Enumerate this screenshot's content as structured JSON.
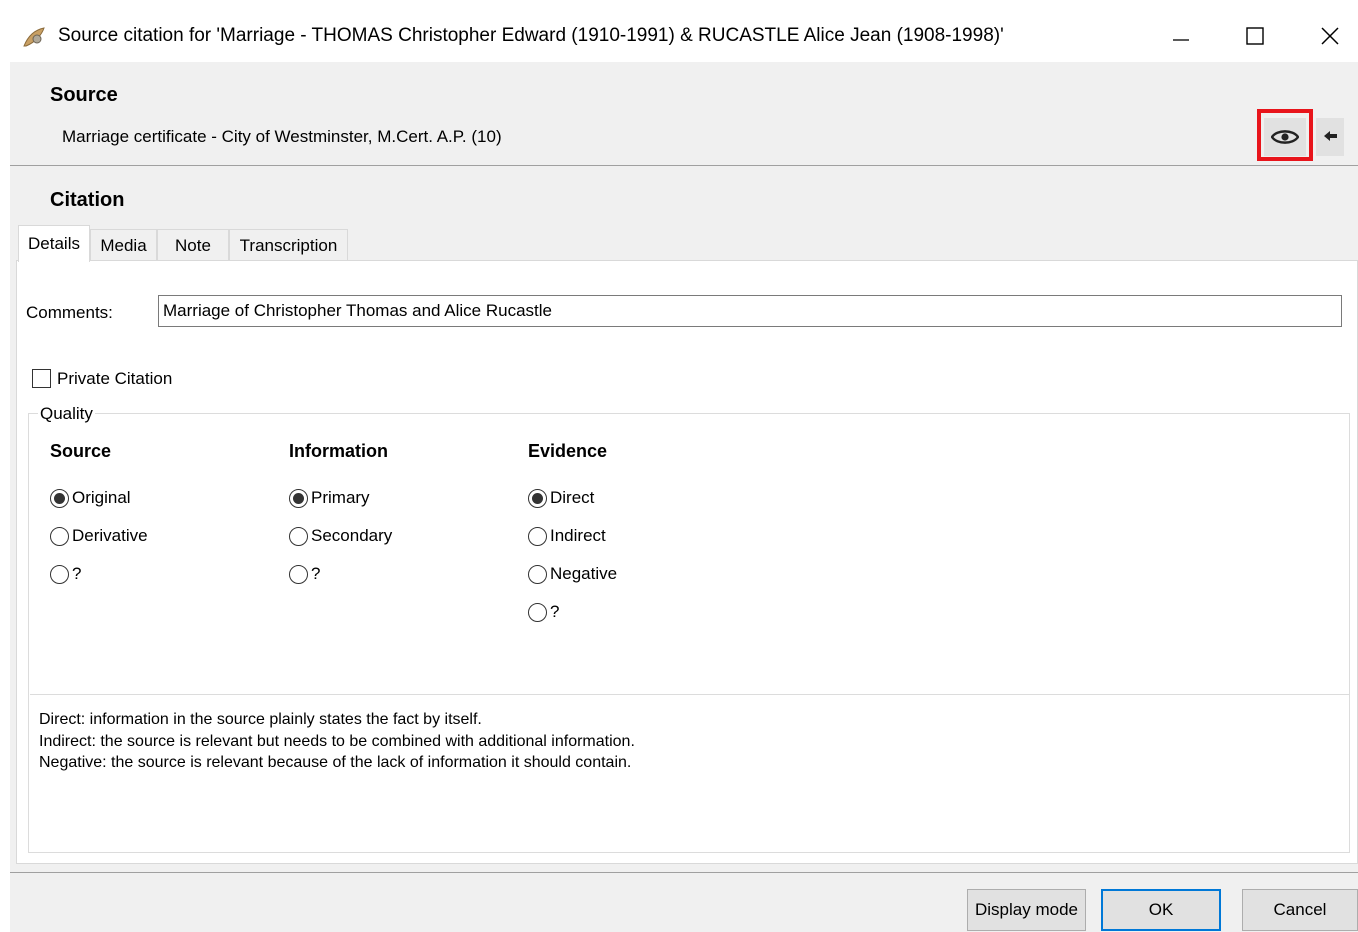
{
  "window": {
    "title": "Source citation for 'Marriage - THOMAS Christopher Edward (1910-1991) & RUCASTLE Alice Jean (1908-1998)'",
    "controls": [
      "minimize-icon",
      "maximize-icon",
      "close-icon"
    ]
  },
  "source": {
    "heading": "Source",
    "value": "Marriage certificate - City of Westminster, M.Cert. A.P. (10)",
    "view_icon": "eye-icon",
    "go_icon": "arrow-left-icon",
    "highlight_color": "#e8141b"
  },
  "citation": {
    "heading": "Citation",
    "tabs": [
      {
        "label": "Details",
        "active": true
      },
      {
        "label": "Media",
        "active": false
      },
      {
        "label": "Note",
        "active": false
      },
      {
        "label": "Transcription",
        "active": false
      }
    ],
    "comments_label": "Comments:",
    "comments_value": "Marriage of Christopher Thomas and Alice Rucastle",
    "private_label": "Private Citation",
    "private_checked": false,
    "quality": {
      "legend": "Quality",
      "source": {
        "heading": "Source",
        "options": [
          "Original",
          "Derivative",
          "?"
        ],
        "selected": "Original"
      },
      "information": {
        "heading": "Information",
        "options": [
          "Primary",
          "Secondary",
          "?"
        ],
        "selected": "Primary"
      },
      "evidence": {
        "heading": "Evidence",
        "options": [
          "Direct",
          "Indirect",
          "Negative",
          "?"
        ],
        "selected": "Direct"
      },
      "help_lines": [
        "Direct: information in the source plainly states the fact by itself.",
        "Indirect: the source is relevant but needs to be combined with additional information.",
        "Negative: the source is relevant because of the lack of information it should contain."
      ]
    }
  },
  "buttons": {
    "display_mode": "Display mode",
    "ok": "OK",
    "cancel": "Cancel"
  },
  "colors": {
    "panel": "#f0f0f0",
    "default_button_border": "#0078d7"
  }
}
